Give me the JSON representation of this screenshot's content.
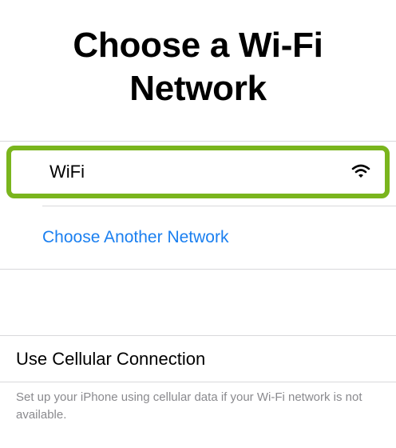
{
  "header": {
    "title_line1": "Choose a Wi-Fi",
    "title_line2": "Network"
  },
  "networks": [
    {
      "name": "WiFi",
      "icon": "wifi-signal-icon",
      "highlighted": true
    }
  ],
  "choose_another": {
    "label": "Choose Another Network"
  },
  "cellular": {
    "label": "Use Cellular Connection",
    "description": "Set up your iPhone using cellular data if your Wi-Fi network is not available."
  },
  "colors": {
    "highlight_border": "#7ab51d",
    "link": "#1a7ff0",
    "footnote": "#8a8a8e",
    "separator": "#d9d9dc"
  }
}
